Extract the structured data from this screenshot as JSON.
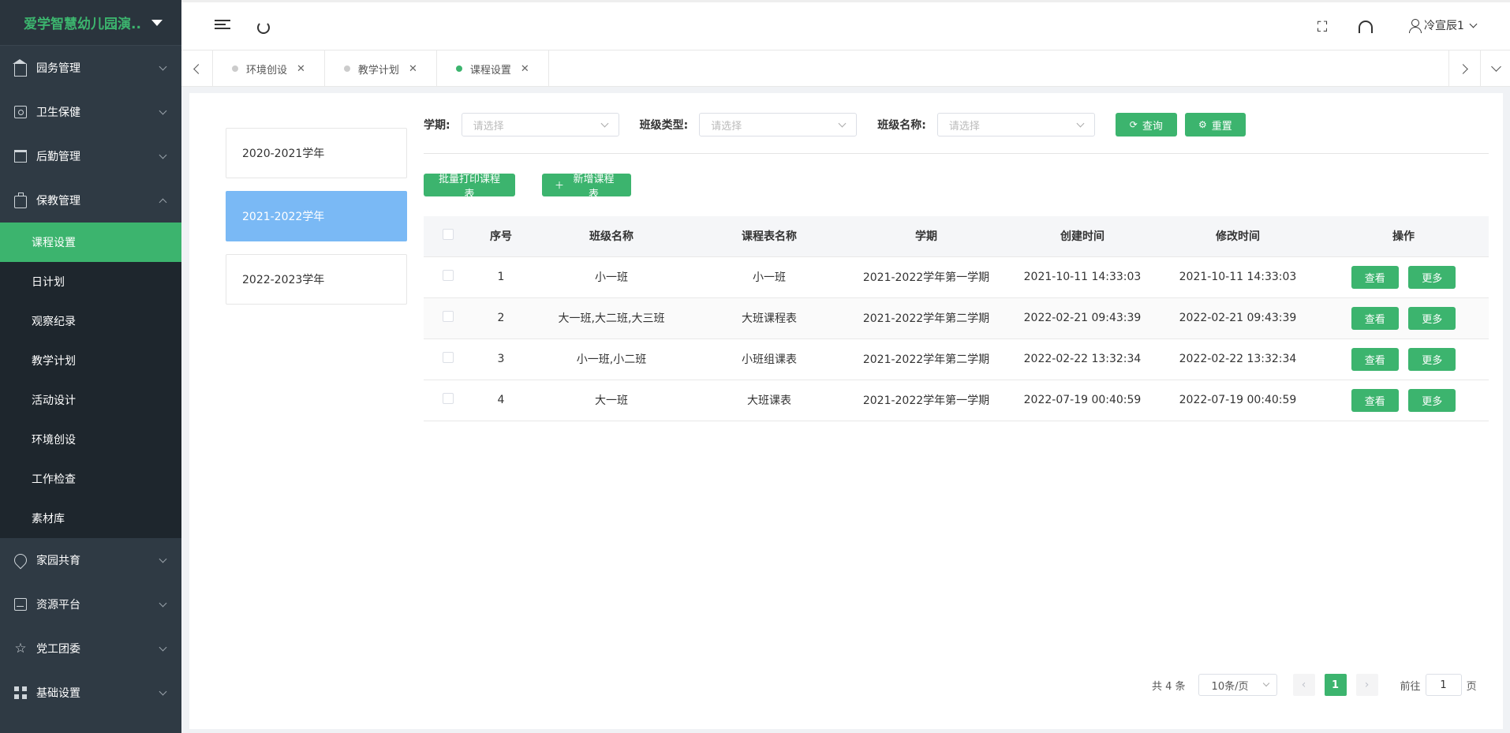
{
  "sidebar": {
    "brand": "爱学智慧幼儿园演...",
    "menu_top": [
      {
        "label": "园务管理",
        "icon": "building-icon"
      },
      {
        "label": "卫生保健",
        "icon": "health-icon"
      },
      {
        "label": "后勤管理",
        "icon": "logistics-icon"
      },
      {
        "label": "保教管理",
        "icon": "briefcase-icon"
      }
    ],
    "submenu": [
      {
        "label": "课程设置",
        "active": true
      },
      {
        "label": "日计划"
      },
      {
        "label": "观察纪录"
      },
      {
        "label": "教学计划"
      },
      {
        "label": "活动设计"
      },
      {
        "label": "环境创设"
      },
      {
        "label": "工作检查"
      },
      {
        "label": "素材库"
      }
    ],
    "menu_bottom": [
      {
        "label": "家园共育",
        "icon": "location-icon"
      },
      {
        "label": "资源平台",
        "icon": "inbox-icon"
      },
      {
        "label": "党工团委",
        "icon": "star-icon"
      },
      {
        "label": "基础设置",
        "icon": "grid-icon"
      }
    ]
  },
  "header": {
    "user_name": "冷宣辰1"
  },
  "tabs": [
    {
      "label": "环境创设",
      "active": false
    },
    {
      "label": "教学计划",
      "active": false
    },
    {
      "label": "课程设置",
      "active": true
    }
  ],
  "years": [
    {
      "label": "2020-2021学年",
      "active": false
    },
    {
      "label": "2021-2022学年",
      "active": true
    },
    {
      "label": "2022-2023学年",
      "active": false
    }
  ],
  "filters": {
    "term_label": "学期:",
    "term_placeholder": "请选择",
    "class_type_label": "班级类型:",
    "class_type_placeholder": "请选择",
    "class_name_label": "班级名称:",
    "class_name_placeholder": "请选择",
    "query_label": "查询",
    "reset_label": "重置"
  },
  "actions": {
    "print_label": "批量打印课程表",
    "add_label": "新增课程表"
  },
  "table": {
    "headers": [
      "序号",
      "班级名称",
      "课程表名称",
      "学期",
      "创建时间",
      "修改时间",
      "操作"
    ],
    "rows": [
      {
        "no": "1",
        "class": "小一班",
        "schedule": "小一班",
        "term": "2021-2022学年第一学期",
        "created": "2021-10-11 14:33:03",
        "modified": "2021-10-11 14:33:03"
      },
      {
        "no": "2",
        "class": "大一班,大二班,大三班",
        "schedule": "大班课程表",
        "term": "2021-2022学年第二学期",
        "created": "2022-02-21 09:43:39",
        "modified": "2022-02-21 09:43:39"
      },
      {
        "no": "3",
        "class": "小一班,小二班",
        "schedule": "小班组课表",
        "term": "2021-2022学年第二学期",
        "created": "2022-02-22 13:32:34",
        "modified": "2022-02-22 13:32:34"
      },
      {
        "no": "4",
        "class": "大一班",
        "schedule": "大班课表",
        "term": "2021-2022学年第一学期",
        "created": "2022-07-19 00:40:59",
        "modified": "2022-07-19 00:40:59"
      }
    ],
    "view_label": "查看",
    "more_label": "更多"
  },
  "pagination": {
    "total": "共 4 条",
    "page_size": "10条/页",
    "current": "1",
    "goto_prefix": "前往",
    "goto_value": "1",
    "goto_suffix": "页"
  },
  "colors": {
    "accent": "#3cb46e",
    "sidebar_bg": "#2f3a44",
    "selected_year": "#7ab9f5"
  }
}
